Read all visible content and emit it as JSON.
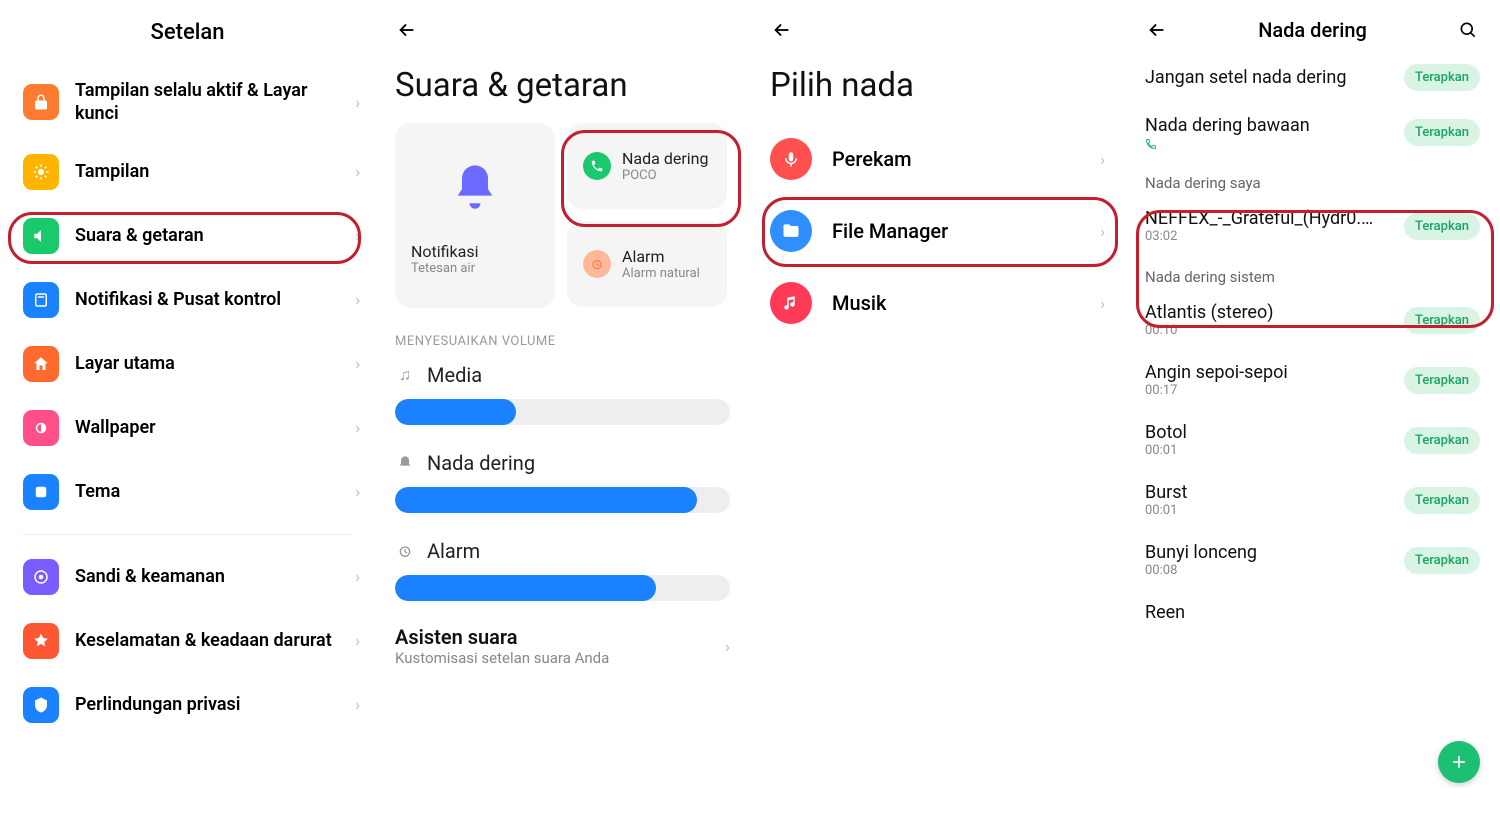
{
  "panel1": {
    "title": "Setelan",
    "items": [
      {
        "label": "Tampilan selalu aktif & Layar kunci",
        "icon_bg": "#ff7b2f",
        "icon_name": "lock-icon"
      },
      {
        "label": "Tampilan",
        "icon_bg": "#ffb400",
        "icon_name": "sun-icon"
      },
      {
        "label": "Suara & getaran",
        "icon_bg": "#19c96c",
        "icon_name": "volume-icon"
      },
      {
        "label": "Notifikasi & Pusat kontrol",
        "icon_bg": "#1a82ff",
        "icon_name": "notification-icon"
      },
      {
        "label": "Layar utama",
        "icon_bg": "#ff6a2f",
        "icon_name": "home-icon"
      },
      {
        "label": "Wallpaper",
        "icon_bg": "#ff4f88",
        "icon_name": "wallpaper-icon"
      },
      {
        "label": "Tema",
        "icon_bg": "#1a82ff",
        "icon_name": "theme-icon"
      },
      {
        "label": "Sandi & keamanan",
        "icon_bg": "#7a5cff",
        "icon_name": "security-icon"
      },
      {
        "label": "Keselamatan & keadaan darurat",
        "icon_bg": "#ff5733",
        "icon_name": "emergency-icon"
      },
      {
        "label": "Perlindungan privasi",
        "icon_bg": "#1a82ff",
        "icon_name": "privacy-icon"
      }
    ]
  },
  "panel2": {
    "title": "Suara & getaran",
    "notif_card": {
      "title": "Notifikasi",
      "sub": "Tetesan air"
    },
    "ringtone_card": {
      "title": "Nada dering",
      "sub": "POCO"
    },
    "alarm_card": {
      "title": "Alarm",
      "sub": "Alarm natural"
    },
    "volume_section": "MENYESUAIKAN VOLUME",
    "sliders": [
      {
        "label": "Media",
        "value": 36
      },
      {
        "label": "Nada dering",
        "value": 90
      },
      {
        "label": "Alarm",
        "value": 78
      }
    ],
    "assistant": {
      "title": "Asisten suara",
      "sub": "Kustomisasi setelan suara Anda"
    }
  },
  "panel3": {
    "title": "Pilih nada",
    "items": [
      {
        "label": "Perekam",
        "bg": "#ff4f4f",
        "icon_name": "mic-icon"
      },
      {
        "label": "File Manager",
        "bg": "#2f8fff",
        "icon_name": "folder-icon"
      },
      {
        "label": "Musik",
        "bg": "#ff3a57",
        "icon_name": "music-icon"
      }
    ]
  },
  "panel4": {
    "title": "Nada dering",
    "apply_label": "Terapkan",
    "top_items": [
      {
        "title": "Jangan setel nada dering"
      },
      {
        "title": "Nada dering bawaan",
        "phone_sub": true
      }
    ],
    "my_section": "Nada dering saya",
    "my_items": [
      {
        "title": "NEFFEX_-_Grateful_(Hydr0....",
        "sub": "03:02"
      }
    ],
    "sys_section": "Nada dering sistem",
    "sys_items": [
      {
        "title": "Atlantis (stereo)",
        "sub": "00:10"
      },
      {
        "title": "Angin sepoi-sepoi",
        "sub": "00:17"
      },
      {
        "title": "Botol",
        "sub": "00:01"
      },
      {
        "title": "Burst",
        "sub": "00:01"
      },
      {
        "title": "Bunyi lonceng",
        "sub": "00:08"
      },
      {
        "title": "Reen",
        "sub": ""
      }
    ]
  }
}
